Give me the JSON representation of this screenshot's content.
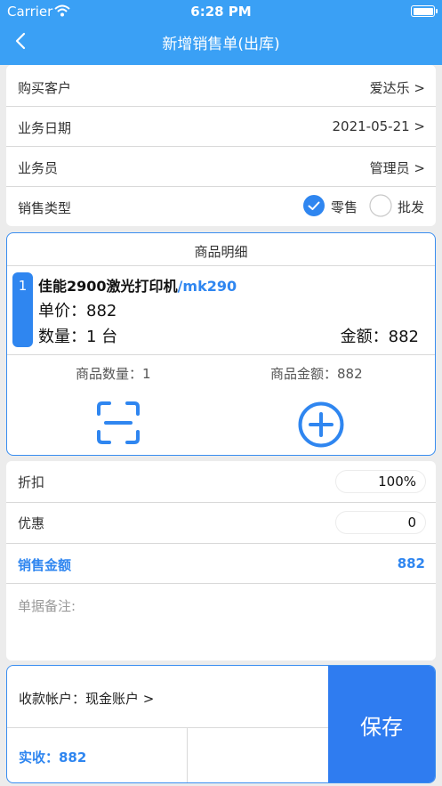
{
  "status_bar": {
    "carrier": "Carrier",
    "time": "6:28 PM"
  },
  "nav": {
    "title": "新增销售单(出库)",
    "back_icon": "chevron-left-icon"
  },
  "form": {
    "customer": {
      "label": "购买客户",
      "value": "爱达乐 >"
    },
    "date": {
      "label": "业务日期",
      "value": "2021-05-21 >"
    },
    "salesperson": {
      "label": "业务员",
      "value": "管理员 >"
    },
    "sale_type": {
      "label": "销售类型",
      "options": [
        {
          "label": "零售",
          "selected": true
        },
        {
          "label": "批发",
          "selected": false
        }
      ]
    }
  },
  "details": {
    "title": "商品明细",
    "items": [
      {
        "index": "1",
        "name": "佳能2900激光打印机",
        "code": "/mk290",
        "price": "单价：882",
        "quantity": "数量：1 台",
        "amount": "金额：882"
      }
    ],
    "summary_qty": "商品数量：1",
    "summary_amount": "商品金额：882"
  },
  "pricing": {
    "discount": {
      "label": "折扣",
      "value": "100%"
    },
    "offer": {
      "label": "优惠",
      "value": "0"
    },
    "sales_amount": {
      "label": "销售金额",
      "value": "882"
    },
    "notes_label": "单据备注:"
  },
  "footer": {
    "account": "收款帐户：现金账户 >",
    "received": "实收：882",
    "save_label": "保存"
  },
  "colors": {
    "header": "#3aa0f5",
    "accent": "#2f86f0",
    "save": "#2f7cf0"
  }
}
